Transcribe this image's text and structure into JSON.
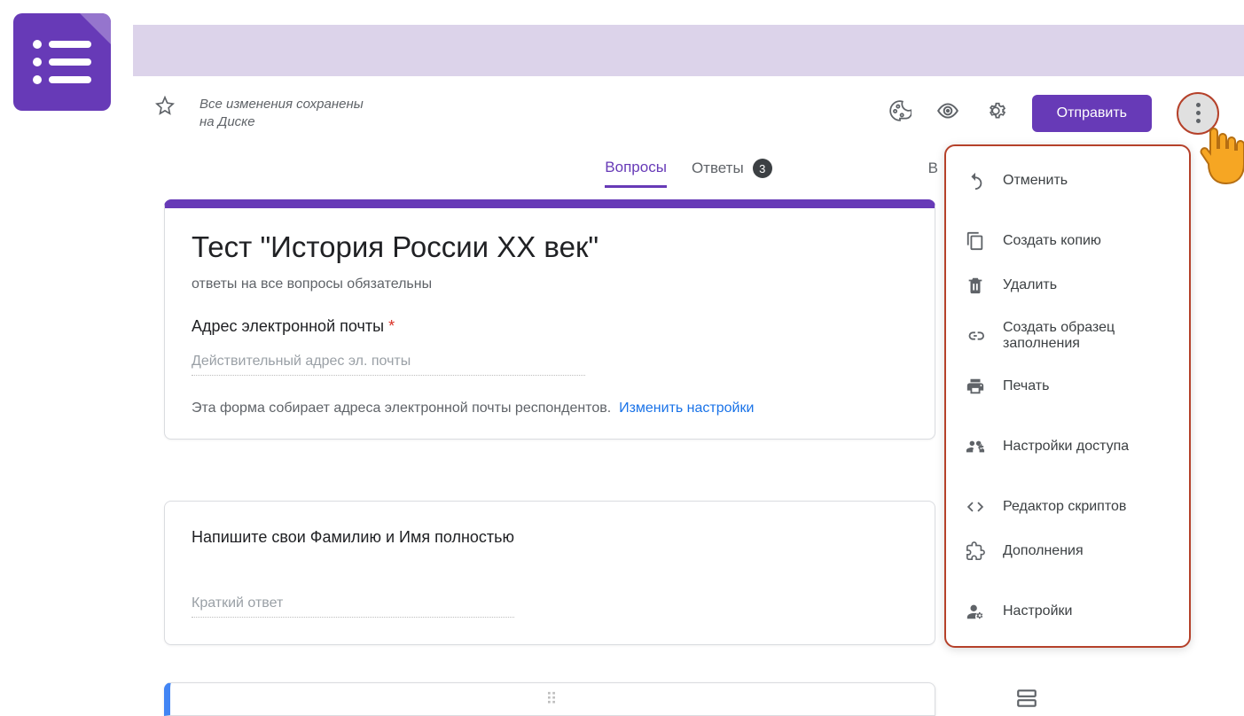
{
  "toolbar": {
    "save_status_line1": "Все изменения сохранены",
    "save_status_line2": "на Диске",
    "send_label": "Отправить"
  },
  "tabs": {
    "questions": "Вопросы",
    "answers": "Ответы",
    "answers_badge": "3",
    "hidden_letter": "В"
  },
  "form": {
    "title": "Тест \"История России XX век\"",
    "description": "ответы на все вопросы обязательны",
    "email_label": "Адрес электронной почты",
    "email_placeholder": "Действительный адрес эл. почты",
    "collect_notice": "Эта форма собирает адреса электронной почты респондентов.",
    "change_settings": "Изменить настройки"
  },
  "question1": {
    "title": "Напишите свои Фамилию и Имя полностью",
    "placeholder": "Краткий ответ"
  },
  "menu": {
    "undo": "Отменить",
    "copy": "Создать копию",
    "delete": "Удалить",
    "prefill": "Создать образец заполнения",
    "print": "Печать",
    "access": "Настройки доступа",
    "script": "Редактор скриптов",
    "addons": "Дополнения",
    "settings": "Настройки"
  }
}
